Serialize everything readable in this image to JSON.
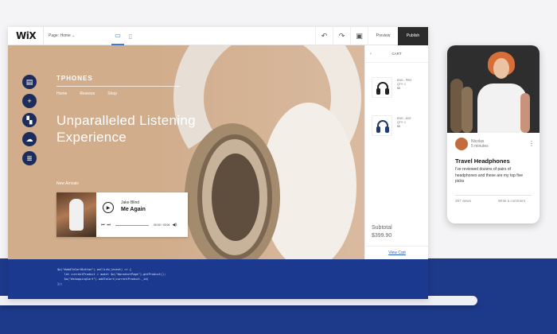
{
  "editor": {
    "logo": "WiX",
    "page_select": "Page: Home ⌄",
    "icons": {
      "desktop": "desktop-icon",
      "mobile": "mobile-icon",
      "undo": "undo-icon",
      "redo": "redo-icon",
      "save": "save-icon"
    },
    "preview_label": "Preview",
    "publish_label": "Publish"
  },
  "site": {
    "brand": "TPHONES",
    "nav": [
      "Home",
      "Reviews",
      "Shop"
    ],
    "headline": "Unparalleled Listening Experience",
    "section_label": "New Arrivals",
    "side_tools": [
      "page-icon",
      "add-icon",
      "apps-icon",
      "cloud-upload-icon",
      "database-icon"
    ]
  },
  "player": {
    "artist": "Jake Blind",
    "song": "Me Again",
    "time": "00:00 / 03:04"
  },
  "cart": {
    "title": "CART",
    "items": [
      {
        "line1": "ENG - PRO",
        "line2": "QTY: 1",
        "line3": "$$"
      },
      {
        "line1": "ENG - ACE",
        "line2": "QTY: 1",
        "line3": "$$"
      }
    ],
    "subtotal_label": "Subtotal",
    "subtotal_value": "$399.90",
    "view_cart": "View Cart"
  },
  "code": {
    "lines": [
      "$w(\"#addToCartButton\").onClick((event) => {",
      "    let currentProduct = await $w(\"#productPage\").getProduct();",
      "    $w(\"#shoppingCart\").addToCart(currentProduct._id)",
      "});"
    ]
  },
  "post": {
    "author": "Nicolas",
    "time": "5 minutes",
    "title": "Travel Headphones",
    "excerpt": "I've reviewed dozens of pairs of headphones and these are my top five picks",
    "views": "257 views",
    "comment_label": "Write a comment"
  },
  "colors": {
    "canvas": "#d1ad8c",
    "rail_buttons": "#1c2d5c",
    "code_bg": "#1b3a8f",
    "link": "#2b5fc4",
    "publish_bg": "#2b2b2b"
  }
}
